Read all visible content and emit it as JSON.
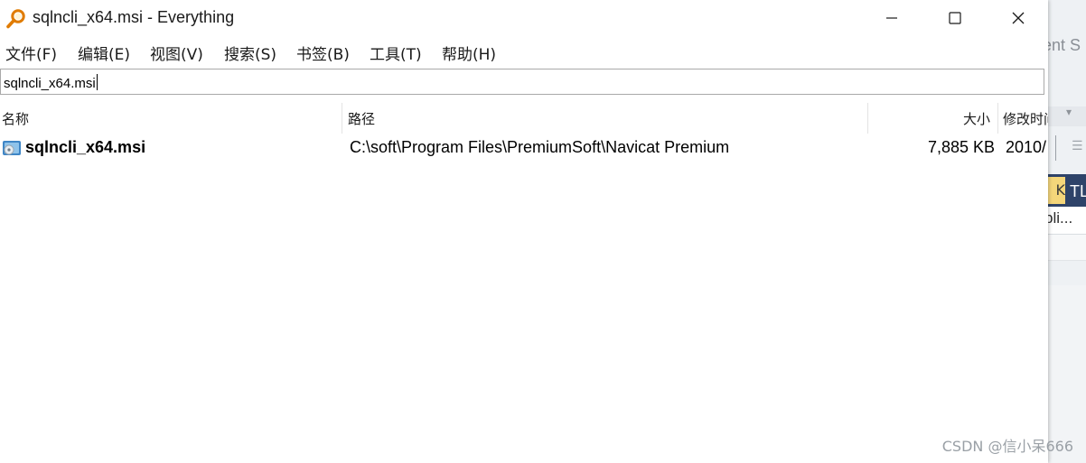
{
  "window": {
    "title": "sqlncli_x64.msi - Everything",
    "controls": {
      "minimize": "minimize",
      "maximize": "maximize",
      "close": "close"
    }
  },
  "menu": [
    {
      "label": "文件(F)"
    },
    {
      "label": "编辑(E)"
    },
    {
      "label": "视图(V)"
    },
    {
      "label": "搜索(S)"
    },
    {
      "label": "书签(B)"
    },
    {
      "label": "工具(T)"
    },
    {
      "label": "帮助(H)"
    }
  ],
  "search": {
    "value": "sqlncli_x64.msi"
  },
  "columns": {
    "name": "名称",
    "path": "路径",
    "size": "大小",
    "modified": "修改时间"
  },
  "results": [
    {
      "name": "sqlncli_x64.msi",
      "path": "C:\\soft\\Program Files\\PremiumSoft\\Navicat Premium",
      "size": "7,885 KB",
      "modified": "2010/"
    }
  ],
  "background_app": {
    "title_fragment": "nent S",
    "tab_fragment": "TL",
    "yellow_fragment": "K",
    "row_fragment": "pli..."
  },
  "watermark": "CSDN @信小呆666",
  "colors": {
    "navy": "#2e4369",
    "yellow": "#f4d67a",
    "icon_orange": "#e07b00"
  }
}
